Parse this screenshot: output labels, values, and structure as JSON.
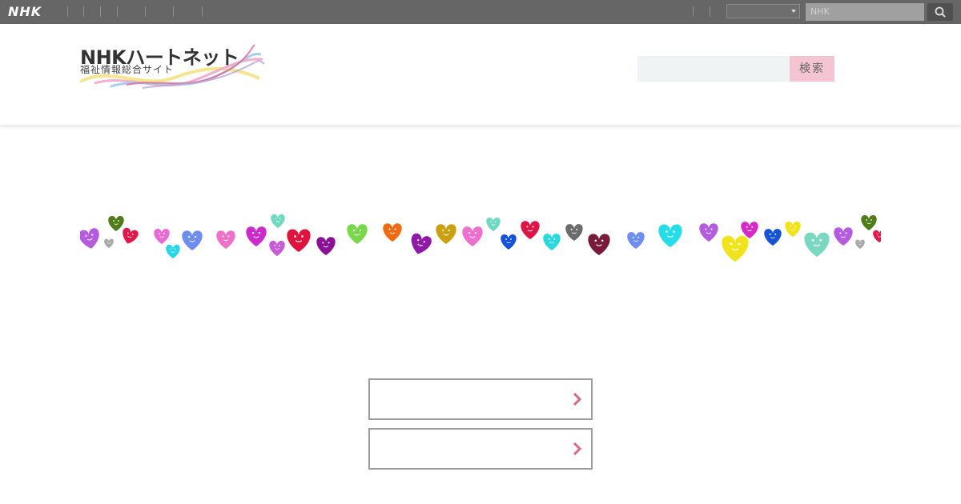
{
  "nhk_bar": {
    "logo_text": "NHK",
    "search_placeholder": "NHK",
    "search_icon": "search-icon",
    "select_value": ""
  },
  "header": {
    "logo_main": "NHKハートネット",
    "logo_sub": "福祉情報総合サイト",
    "search_placeholder": "",
    "search_button_label": "検索"
  },
  "links": [
    {
      "label": "",
      "icon": "chevron-right-icon"
    },
    {
      "label": "",
      "icon": "chevron-right-icon"
    }
  ],
  "colors": {
    "top_bar": "#666666",
    "search_button": "#f4c4d2",
    "chevron": "#d86a7f",
    "button_border": "#9c9c9c"
  }
}
